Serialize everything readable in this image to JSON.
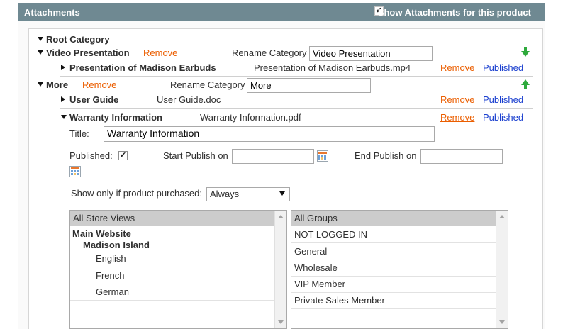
{
  "header": {
    "title": "Attachments",
    "show_label": "Show Attachments for this product",
    "show_checked": "✔"
  },
  "tree": {
    "root": "Root Category",
    "video": {
      "label": "Video Presentation",
      "remove": "Remove",
      "rename_label": "Rename Category",
      "rename_value": "Video Presentation"
    },
    "madison": {
      "label": "Presentation of Madison Earbuds",
      "file": "Presentation of Madison Earbuds.mp4",
      "remove": "Remove",
      "status": "Published"
    },
    "more": {
      "label": "More",
      "remove": "Remove",
      "rename_label": "Rename Category",
      "rename_value": "More"
    },
    "guide": {
      "label": "User Guide",
      "file": "User Guide.doc",
      "remove": "Remove",
      "status": "Published"
    },
    "warranty": {
      "label": "Warranty Information",
      "file": "Warranty Information.pdf",
      "remove": "Remove",
      "status": "Published"
    }
  },
  "form": {
    "title_label": "Title:",
    "title_value": "Warranty Information",
    "published_label": "Published:",
    "published_checked": "✔",
    "start_label": "Start Publish on",
    "start_value": "",
    "end_label": "End Publish on",
    "end_value": "",
    "purchase_label": "Show only if product purchased:",
    "purchase_value": "Always"
  },
  "store_views": {
    "header": "All Store Views",
    "website": "Main Website",
    "store": "Madison Island",
    "views": [
      "English",
      "French",
      "German"
    ]
  },
  "groups": {
    "header": "All Groups",
    "items": [
      "NOT LOGGED IN",
      "General",
      "Wholesale",
      "VIP Member",
      "Private Sales Member"
    ]
  },
  "colors": {
    "header_bg": "#6f8992",
    "remove": "#eb5e00",
    "published": "#1a3fcf",
    "arrow": "#2eaa3c"
  }
}
